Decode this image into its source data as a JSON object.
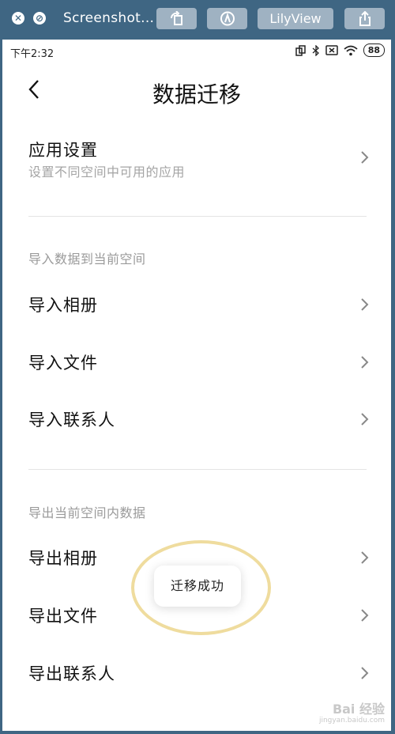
{
  "viewer": {
    "title": "Screenshot...",
    "view_button": "LilyView",
    "icons": [
      "close-icon",
      "cancel-icon",
      "rotate-icon",
      "markup-icon",
      "share-icon"
    ]
  },
  "status_bar": {
    "time": "下午2:32",
    "battery": "88"
  },
  "header": {
    "title": "数据迁移"
  },
  "app_settings": {
    "label": "应用设置",
    "sub": "设置不同空间中可用的应用"
  },
  "import_section": {
    "title": "导入数据到当前空间",
    "items": [
      {
        "label": "导入相册"
      },
      {
        "label": "导入文件"
      },
      {
        "label": "导入联系人"
      }
    ]
  },
  "export_section": {
    "title": "导出当前空间内数据",
    "items": [
      {
        "label": "导出相册"
      },
      {
        "label": "导出文件"
      },
      {
        "label": "导出联系人"
      }
    ]
  },
  "toast": {
    "message": "迁移成功"
  },
  "watermark": {
    "text": "Bai 经验",
    "url": "jingyan.baidu.com"
  },
  "colors": {
    "frame": "#3f6683",
    "toast_highlight": "#efdc9e",
    "secondary_text": "#a4a4a4"
  }
}
